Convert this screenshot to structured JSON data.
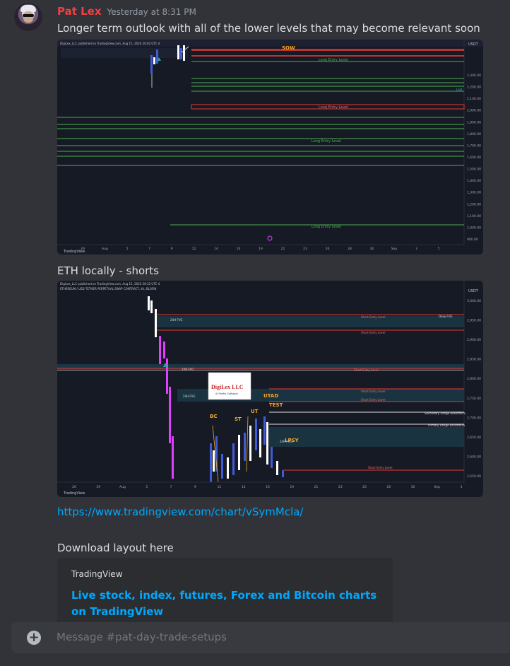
{
  "message": {
    "username": "Pat Lex",
    "timestamp": "Yesterday at 8:31 PM",
    "text1": "Longer term outlook with all of the lower levels that may become relevant soon",
    "text2": "ETH locally - shorts",
    "link": "https://www.tradingview.com/chart/vSymMcla/",
    "text3": "Download layout here"
  },
  "chart1": {
    "publisher": "DigiLex_LLC published on TradingView.com, Aug 15, 2024 20:02 UTC-4",
    "currency": "USDT",
    "marker": "SOW",
    "level_label": "Long Entry Level",
    "last_label": "Last",
    "price_ticks": [
      "2,300.00",
      "2,200.00",
      "2,100.00",
      "2,000.00",
      "1,900.00",
      "1,800.00",
      "1,700.00",
      "1,600.00",
      "1,500.00",
      "1,400.00",
      "1,300.00",
      "1,200.00",
      "1,100.00",
      "1,000.00",
      "900.00"
    ],
    "time_ticks": [
      "29",
      "Aug",
      "5",
      "7",
      "9",
      "12",
      "14",
      "16",
      "19",
      "21",
      "23",
      "26",
      "28",
      "30",
      "Sep",
      "3",
      "5"
    ],
    "brand": "TradingView"
  },
  "chart2": {
    "publisher": "DigiLex_LLC published on TradingView.com, Aug 15, 2024 20:32 UTC-4",
    "symbol": "ETHEREUM / USD TETHER PERPETUAL SWAP CONTRACT, 4h, BLOFIN",
    "currency": "USDT",
    "logo_text": "DigiLex LLC",
    "logo_sub": "AI Profits Software",
    "annotations": [
      "BC",
      "ST",
      "UT",
      "UTAD",
      "TEST",
      "LPSY"
    ],
    "fvg_labels": [
      "24H FVG",
      "24H FVG",
      "24H FVG",
      "24H FVG"
    ],
    "short_label": "Short Entry Level",
    "levels": [
      "Secondary Range Resistance",
      "Primary Range Resistance",
      "Daily FVG"
    ],
    "price_ticks": [
      "3,000.00",
      "2,950.00",
      "2,900.00",
      "2,850.00",
      "2,800.00",
      "2,750.00",
      "2,700.00",
      "2,650.00",
      "2,600.00",
      "2,550.00"
    ],
    "time_ticks": [
      "26",
      "29",
      "Aug",
      "5",
      "7",
      "9",
      "12",
      "14",
      "16",
      "19",
      "21",
      "23",
      "26",
      "28",
      "30",
      "Sep",
      "3"
    ],
    "brand": "TradingView"
  },
  "embed": {
    "provider": "TradingView",
    "title": "Live stock, index, futures, Forex and Bitcoin charts on TradingView"
  },
  "composer": {
    "placeholder": "Message #pat-day-trade-setups"
  },
  "colors": {
    "username": "#f23f42",
    "link": "#00a8fc",
    "long_level": "#4caf50",
    "short_level": "#e53935",
    "candle_up": "#3f5bd6",
    "candle_down": "#ffffff",
    "magenta": "#e040fb"
  }
}
